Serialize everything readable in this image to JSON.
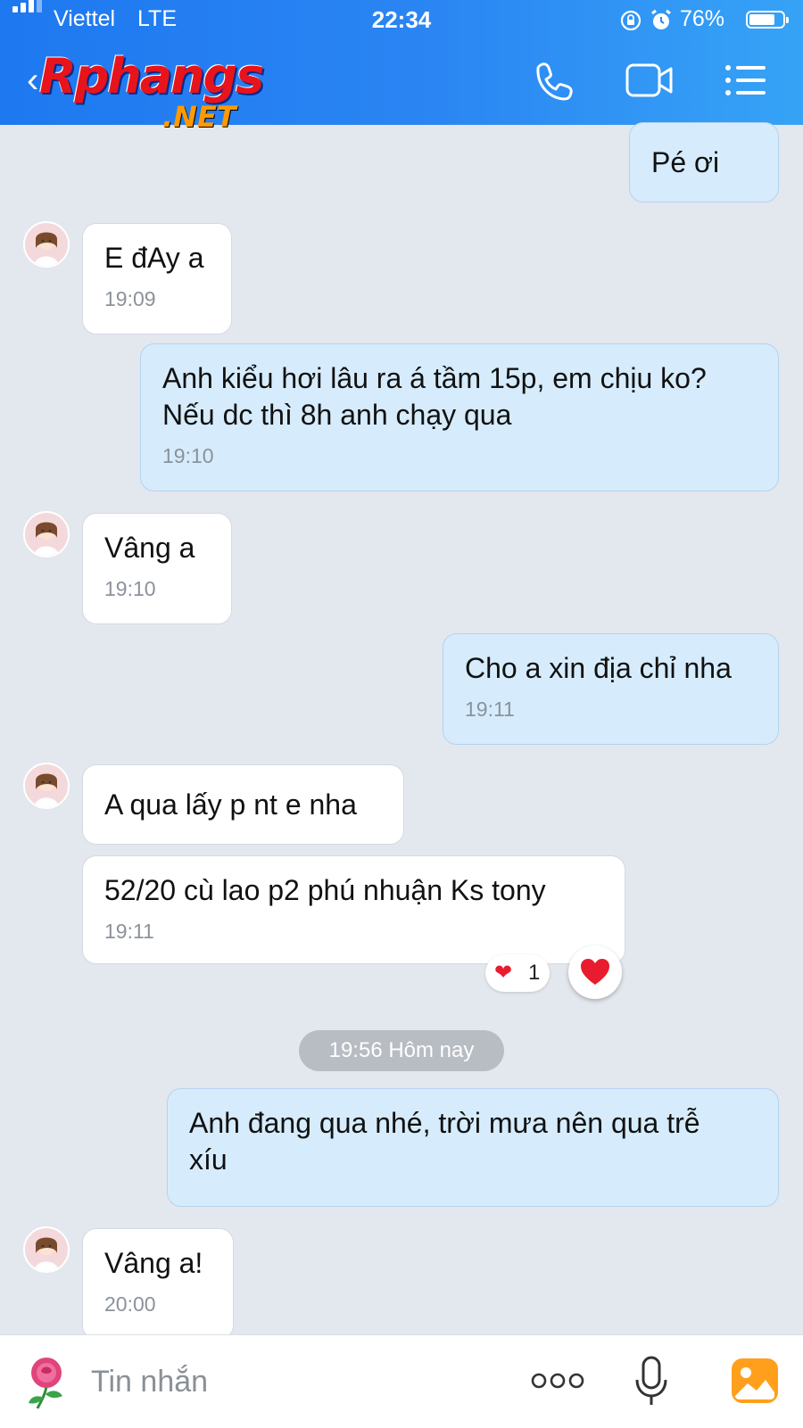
{
  "status_bar": {
    "carrier": "Viettel",
    "network": "LTE",
    "time": "22:34",
    "battery_percent": "76%",
    "battery_level": 0.76
  },
  "header": {
    "logo_main": "Rphangs",
    "logo_sub": ".NET",
    "icons": [
      "back-icon",
      "phone-icon",
      "video-icon",
      "menu-icon"
    ]
  },
  "messages": [
    {
      "dir": "out",
      "text": "Pé ơi",
      "time": ""
    },
    {
      "dir": "in",
      "text": "E đAy a",
      "time": "19:09"
    },
    {
      "dir": "out",
      "text": "Anh kiểu hơi lâu ra á tầm 15p, em chịu ko?",
      "text2": "Nếu dc thì 8h anh chạy qua",
      "time": "19:10"
    },
    {
      "dir": "in",
      "text": "Vâng a",
      "time": "19:10"
    },
    {
      "dir": "out",
      "text": "Cho a xin địa chỉ nha",
      "time": "19:11"
    },
    {
      "dir": "in",
      "text": "A qua lấy p nt e nha",
      "time": ""
    },
    {
      "dir": "in",
      "text": "52/20 cù lao p2 phú nhuận Ks tony",
      "time": "19:11",
      "reaction": {
        "emoji": "❤",
        "count": "1"
      }
    },
    {
      "dir": "out",
      "text": "Anh đang qua nhé, trời mưa nên qua trễ",
      "text2": "xíu",
      "time": ""
    },
    {
      "dir": "in",
      "text": "Vâng a!",
      "time": "20:00"
    }
  ],
  "divider": {
    "label": "19:56 Hôm nay"
  },
  "input": {
    "placeholder": "Tin nhắn",
    "icons": [
      "rose-sticker-icon",
      "more-icon",
      "mic-icon",
      "gallery-icon"
    ]
  },
  "colors": {
    "header_start": "#1e78f0",
    "header_end": "#36a3f6",
    "outgoing_bubble": "#d6ecfc",
    "incoming_bubble": "#ffffff",
    "background": "#e3e7ee",
    "heart": "#e81c2e"
  }
}
